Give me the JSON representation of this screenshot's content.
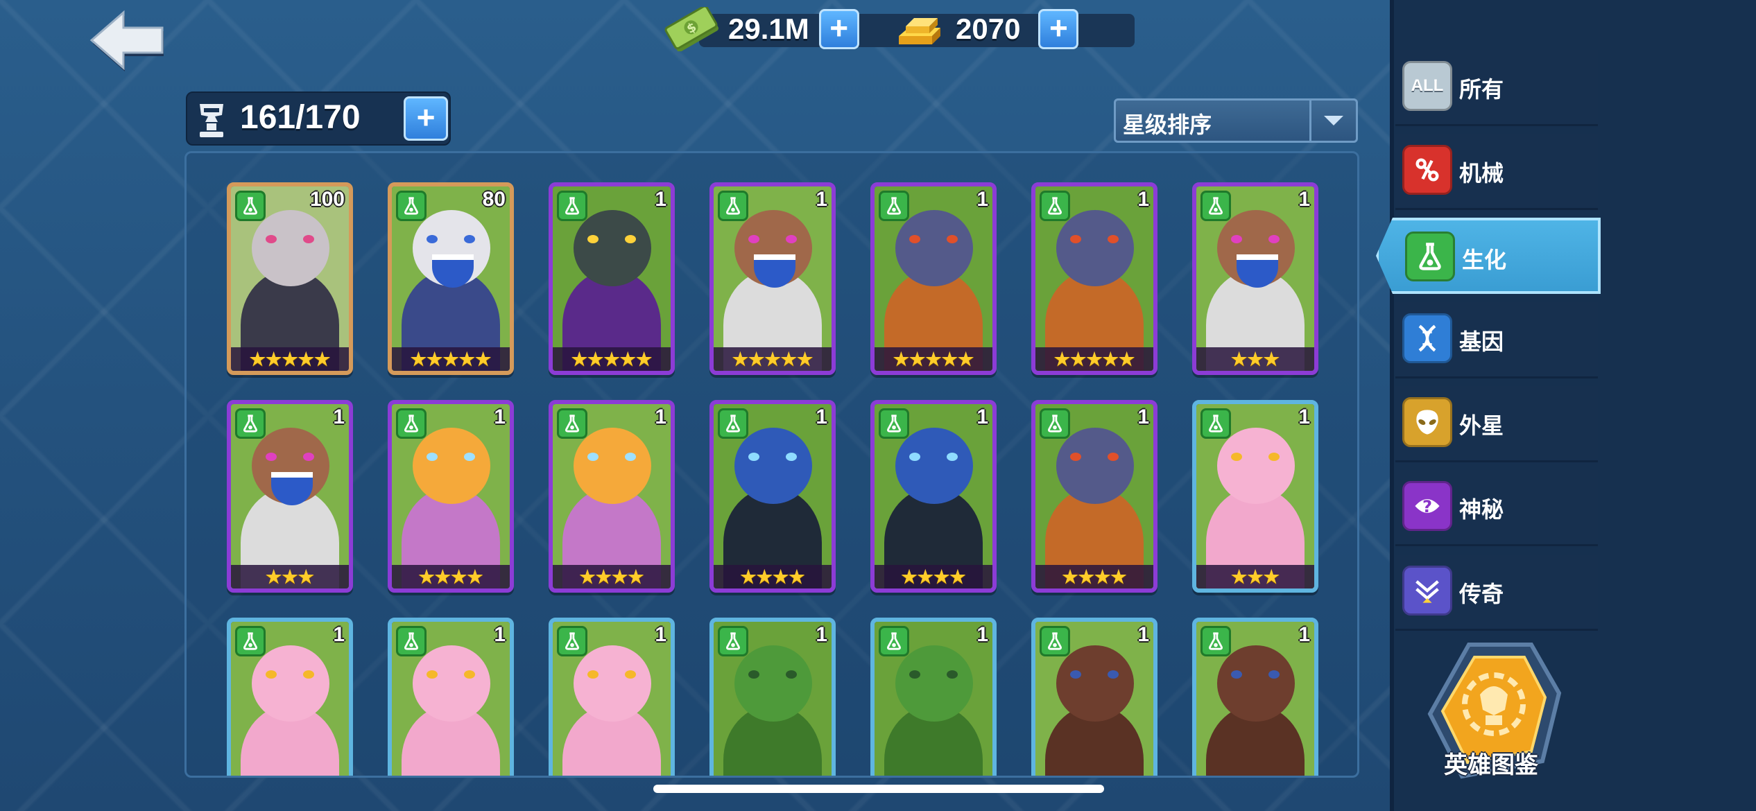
{
  "topbar": {
    "cash": {
      "icon": "cash-icon",
      "amount": "29.1M"
    },
    "gold": {
      "icon": "gold-bar-icon",
      "amount": "2070"
    },
    "plus": "+"
  },
  "roster": {
    "icon": "hero-capacity-icon",
    "count": "161/170",
    "plus": "+"
  },
  "sort": {
    "selected": "星级排序"
  },
  "cards": [
    {
      "level": "100",
      "stars": "★★★★★",
      "rarity": "orange",
      "theme": "pig-punk"
    },
    {
      "level": "80",
      "stars": "★★★★★",
      "rarity": "orange",
      "theme": "chain-ghoul"
    },
    {
      "level": "1",
      "stars": "★★★★★",
      "rarity": "purple",
      "theme": "robot-hood"
    },
    {
      "level": "1",
      "stars": "★★★★★",
      "rarity": "purple",
      "theme": "brute-pink"
    },
    {
      "level": "1",
      "stars": "★★★★★",
      "rarity": "purple",
      "theme": "ogre-orange"
    },
    {
      "level": "1",
      "stars": "★★★★★",
      "rarity": "purple",
      "theme": "ogre-orange"
    },
    {
      "level": "1",
      "stars": "★★★",
      "rarity": "purple",
      "theme": "brute-pink"
    },
    {
      "level": "1",
      "stars": "★★★",
      "rarity": "purple",
      "theme": "brute-pink"
    },
    {
      "level": "1",
      "stars": "★★★★",
      "rarity": "purple",
      "theme": "zombie-girl"
    },
    {
      "level": "1",
      "stars": "★★★★",
      "rarity": "purple",
      "theme": "zombie-girl"
    },
    {
      "level": "1",
      "stars": "★★★★",
      "rarity": "purple",
      "theme": "blue-gorilla"
    },
    {
      "level": "1",
      "stars": "★★★★",
      "rarity": "purple",
      "theme": "blue-gorilla"
    },
    {
      "level": "1",
      "stars": "★★★★",
      "rarity": "purple",
      "theme": "ogre-orange"
    },
    {
      "level": "1",
      "stars": "★★★",
      "rarity": "blue",
      "theme": "pink-blob"
    },
    {
      "level": "1",
      "stars": "",
      "rarity": "blue",
      "theme": "pink-blob"
    },
    {
      "level": "1",
      "stars": "",
      "rarity": "blue",
      "theme": "pink-blob"
    },
    {
      "level": "1",
      "stars": "",
      "rarity": "blue",
      "theme": "pink-blob"
    },
    {
      "level": "1",
      "stars": "",
      "rarity": "blue",
      "theme": "green-hulk"
    },
    {
      "level": "1",
      "stars": "",
      "rarity": "blue",
      "theme": "green-hulk"
    },
    {
      "level": "1",
      "stars": "",
      "rarity": "blue",
      "theme": "brown-brute"
    },
    {
      "level": "1",
      "stars": "",
      "rarity": "blue",
      "theme": "brown-brute"
    }
  ],
  "categories": [
    {
      "label": "所有",
      "icon": "all-icon",
      "badge_text": "ALL",
      "color": "#b9c9d3",
      "active": false
    },
    {
      "label": "机械",
      "icon": "mechanical-icon",
      "color": "#d8322c",
      "active": false
    },
    {
      "label": "生化",
      "icon": "biochemical-flask-icon",
      "color": "#3bb54a",
      "active": true
    },
    {
      "label": "基因",
      "icon": "dna-icon",
      "color": "#2f7ed6",
      "active": false
    },
    {
      "label": "外星",
      "icon": "alien-icon",
      "color": "#d8a22c",
      "active": false
    },
    {
      "label": "神秘",
      "icon": "mystery-icon",
      "color": "#8a34c8",
      "active": false
    },
    {
      "label": "传奇",
      "icon": "legend-icon",
      "color": "#5b53c9",
      "active": false
    }
  ],
  "codex": {
    "label": "英雄图鉴",
    "icon": "hero-codex-icon"
  },
  "colors": {
    "bg": "#24527e",
    "sidebar": "#16304f",
    "active_tab": "#3a9dd3",
    "star": "#ffcc2a",
    "bio_badge": "#3bb54a"
  }
}
